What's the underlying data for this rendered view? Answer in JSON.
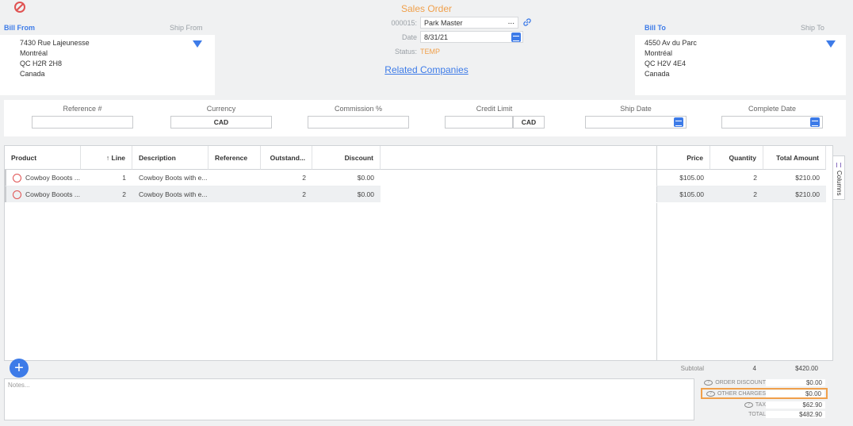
{
  "header": {
    "title": "Sales Order",
    "order_number": "000015:",
    "customer": "Park Master",
    "date_label": "Date",
    "date_value": "8/31/21",
    "status_label": "Status:",
    "status_value": "TEMP",
    "related_link": "Related Companies",
    "ellipsis": "..."
  },
  "bill_from": {
    "tab_active": "Bill From",
    "tab_inactive": "Ship From",
    "lines": [
      "7430 Rue Lajeunesse",
      "Montréal",
      "QC H2R 2H8",
      "Canada"
    ]
  },
  "bill_to": {
    "tab_active": "Bill To",
    "tab_inactive": "Ship To",
    "lines": [
      "4550 Av du Parc",
      "Montréal",
      "QC H2V 4E4",
      "Canada"
    ]
  },
  "fields": {
    "reference_label": "Reference #",
    "reference_value": "",
    "currency_label": "Currency",
    "currency_value": "CAD",
    "commission_label": "Commission %",
    "commission_value": "",
    "credit_limit_label": "Credit Limit",
    "credit_limit_value": "",
    "credit_limit_currency": "CAD",
    "ship_date_label": "Ship Date",
    "ship_date_value": "",
    "complete_date_label": "Complete Date",
    "complete_date_value": ""
  },
  "grid": {
    "headers": {
      "product": "Product",
      "line": "↑ Line",
      "description": "Description",
      "reference": "Reference",
      "outstanding": "Outstand...",
      "discount": "Discount",
      "price": "Price",
      "quantity": "Quantity",
      "total": "Total Amount"
    },
    "rows": [
      {
        "product": "Cowboy Booots ...",
        "line": "1",
        "description": "Cowboy Boots with e...",
        "reference": "",
        "outstanding": "2",
        "discount": "$0.00",
        "price": "$105.00",
        "quantity": "2",
        "total": "$210.00"
      },
      {
        "product": "Cowboy Booots ...",
        "line": "2",
        "description": "Cowboy Boots with e...",
        "reference": "",
        "outstanding": "2",
        "discount": "$0.00",
        "price": "$105.00",
        "quantity": "2",
        "total": "$210.00"
      }
    ],
    "columns_tab": "Columns"
  },
  "footer": {
    "add_symbol": "+",
    "notes_placeholder": "Notes...",
    "subtotal_label": "Subtotal",
    "subtotal_qty": "4",
    "subtotal_value": "$420.00",
    "order_discount_label": "ORDER DISCOUNT",
    "order_discount_value": "$0.00",
    "other_charges_label": "OTHER CHARGES",
    "other_charges_value": "$0.00",
    "tax_label": "TAX",
    "tax_value": "$62.90",
    "total_label": "TOTAL",
    "total_value": "$482.90"
  },
  "colors": {
    "accent": "#3d7be8",
    "status": "#f0a04b",
    "highlight": "#f0a04b",
    "danger": "#e05252"
  }
}
